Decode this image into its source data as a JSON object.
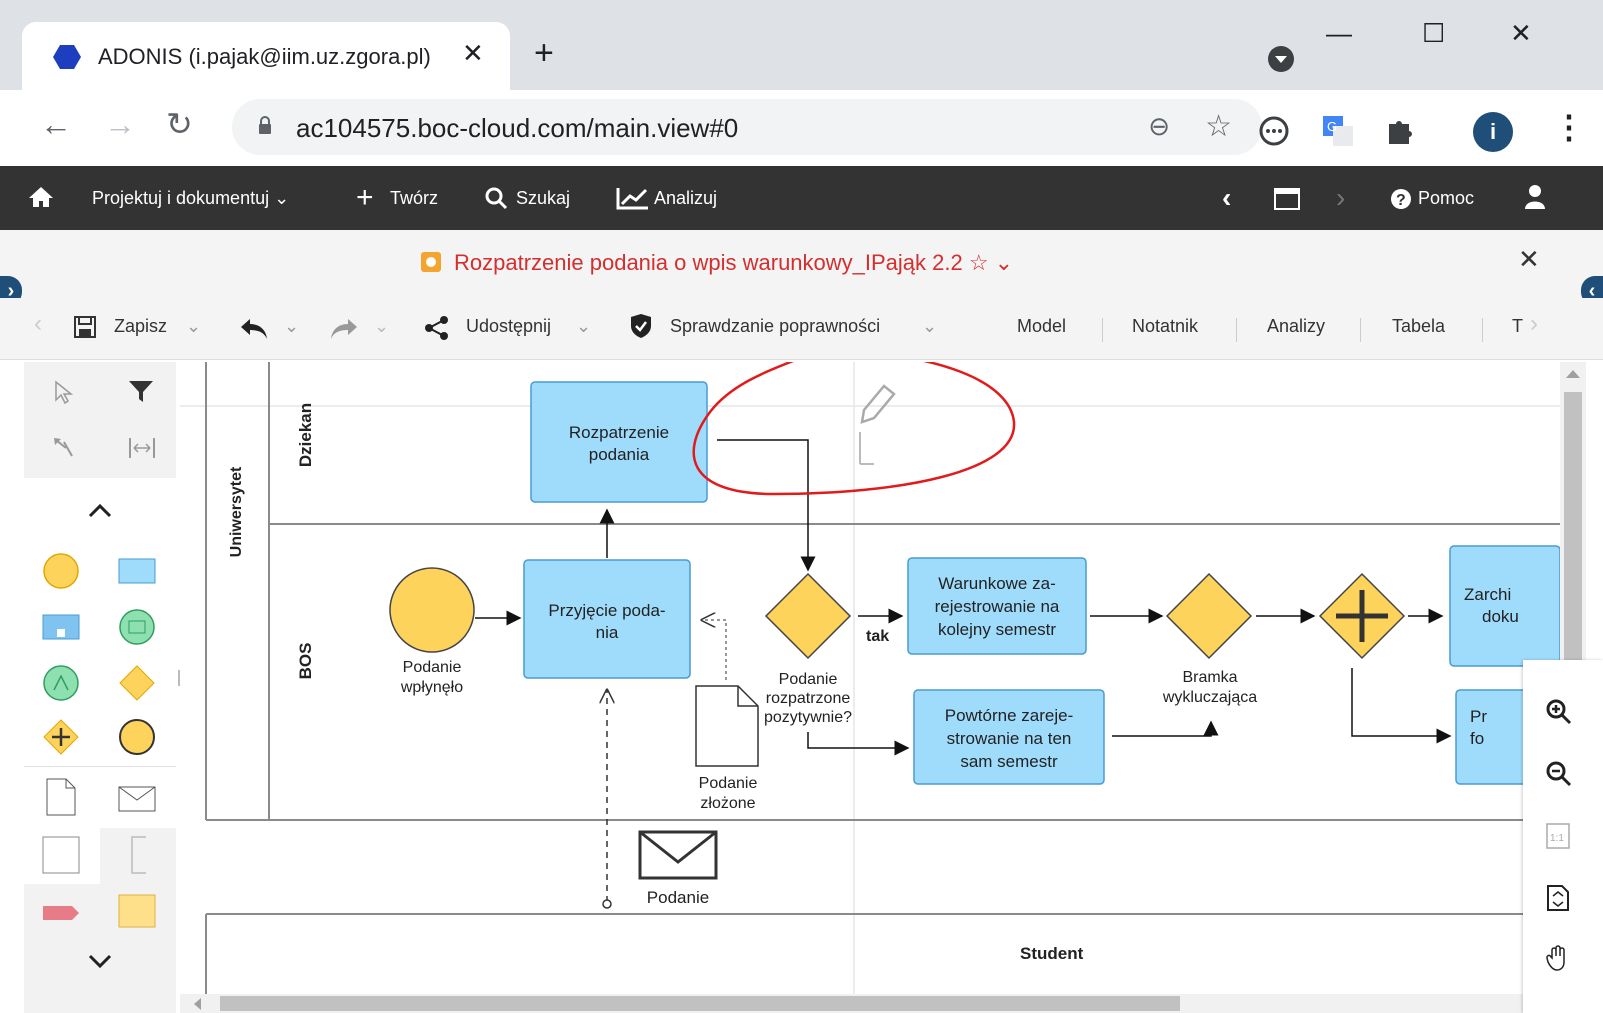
{
  "browser": {
    "tab_title": "ADONIS (i.pajak@iim.uz.zgora.pl)",
    "tab_close": "✕",
    "new_tab": "+",
    "window_minimize": "—",
    "window_maximize": "☐",
    "window_close": "✕",
    "url": "ac104575.boc-cloud.com/main.view#0",
    "profile_initial": "i"
  },
  "appnav": {
    "items": [
      {
        "label": "Projektuj i dokumentuj ⌄"
      },
      {
        "label": "Twórz"
      },
      {
        "label": "Szukaj"
      },
      {
        "label": "Analizuj"
      }
    ],
    "help": "Pomoc"
  },
  "model": {
    "title": "Rozpatrzenie podania o wpis warunkowy_IPająk 2.2 ☆ ⌄",
    "close": "✕"
  },
  "editor_toolbar": {
    "save": "Zapisz",
    "share": "Udostępnij",
    "validate": "Sprawdzanie poprawności",
    "tabs": [
      "Model",
      "Notatnik",
      "Analizy",
      "Tabela",
      "T"
    ]
  },
  "diagram": {
    "pool_label": "Uniwersytet",
    "lanes": [
      "Dziekan",
      "BOS"
    ],
    "student_lane": "Student",
    "tasks": {
      "rozpatrzenie": "Rozpatrzenie podania",
      "przyjecie_1": "Przyjęcie poda-",
      "przyjecie_2": "nia",
      "warunkowe_1": "Warunkowe za-",
      "warunkowe_2": "rejestrowanie na",
      "warunkowe_3": "kolejny semestr",
      "powtorne_1": "Powtórne zareje-",
      "powtorne_2": "strowanie na ten",
      "powtorne_3": "sam semestr",
      "zarch_1": "Zarchi",
      "zarch_2": "doku",
      "pr_1": "Pr",
      "pr_2": "fo"
    },
    "labels": {
      "start_1": "Podanie",
      "start_2": "wpłynęło",
      "gw_1": "Podanie",
      "gw_2": "rozpatrzone",
      "gw_3": "pozytywnie?",
      "tak": "tak",
      "doc_1": "Podanie",
      "doc_2": "złożone",
      "xor_1": "Bramka",
      "xor_2": "wykluczająca",
      "msg": "Podanie"
    }
  },
  "colors": {
    "task_fill": "#9fdcfc",
    "task_stroke": "#4a9bd1",
    "gateway_fill": "#fdd35c",
    "annotation": "#e11b1b"
  }
}
